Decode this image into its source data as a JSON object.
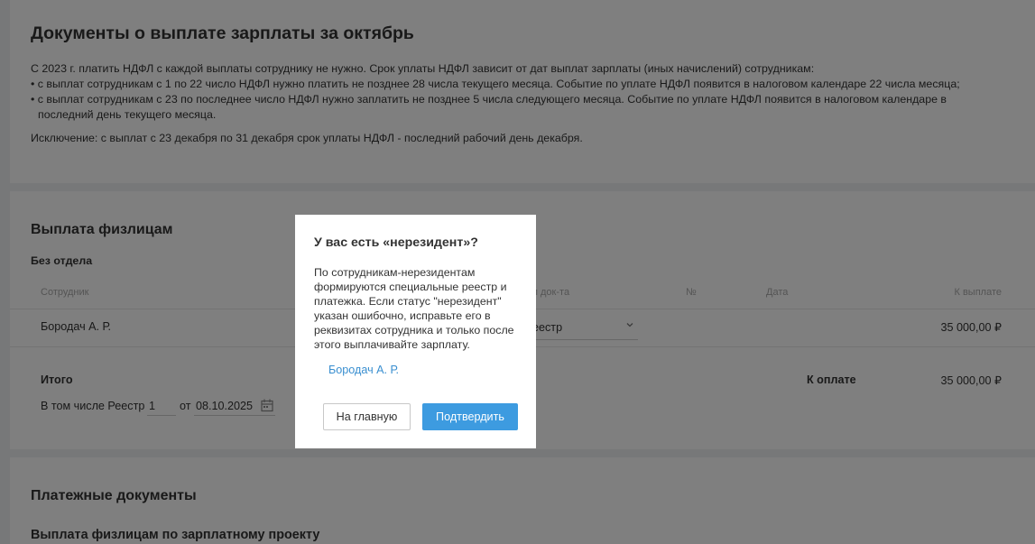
{
  "taxes_card": {
    "title": "Документы о выплате зарплаты за октябрь",
    "intro": "С 2023 г. платить НДФЛ с каждой выплаты сотруднику не нужно. Срок уплаты НДФЛ зависит от дат выплат зарплаты (иных начислений) сотрудникам:",
    "bullet1": "• с выплат сотрудникам с 1 по 22 число НДФЛ нужно платить не позднее 28 числа текущего месяца. Событие по уплате НДФЛ появится в налоговом календаре 22 числа месяца;",
    "bullet2": "• с выплат сотрудникам с 23 по последнее число НДФЛ нужно заплатить не позднее 5 числа следующего месяца. Событие по уплате НДФЛ появится в налоговом календаре в последний день текущего месяца.",
    "exception": "Исключение: с выплат с 23 декабря по 31 декабря срок уплаты НДФЛ - последний рабочий день декабря."
  },
  "payout_card": {
    "title": "Выплата физлицам",
    "department": "Без отдела",
    "columns": {
      "employee": "Сотрудник",
      "doc_type": "п док-та",
      "number": "№",
      "date": "Дата",
      "to_pay": "К выплате"
    },
    "row": {
      "employee": "Бородач А. Р.",
      "doc_type": "еестр",
      "amount": "35 000,00 ₽"
    },
    "total_label": "Итого",
    "to_pay_label": "К оплате",
    "total_amount": "35 000,00 ₽",
    "registry_label": "В том числе Реестр",
    "registry_number": "1",
    "from_label": "от",
    "registry_date": "08.10.2025"
  },
  "payments_card": {
    "title": "Платежные документы",
    "subtitle": "Выплата физлицам по зарплатному проекту"
  },
  "modal": {
    "title": "У вас есть «нерезидент»?",
    "body": "По сотрудникам-нерезидентам формируются специальные реестр и платежка. Если статус \"нерезидент\" указан ошибочно, исправьте его в реквизитах сотрудника и только после этого выплачивайте зарплату.",
    "employee_link": "Бородач А. Р.",
    "home_button": "На главную",
    "confirm_button": "Подтвердить"
  },
  "icons": {
    "select_chevron": "chevron-down-icon",
    "date_picker": "calendar-icon"
  },
  "colors": {
    "accent": "#3d9be0",
    "link": "#3a8fd0",
    "overlay": "rgba(0,0,0,0.5)"
  }
}
